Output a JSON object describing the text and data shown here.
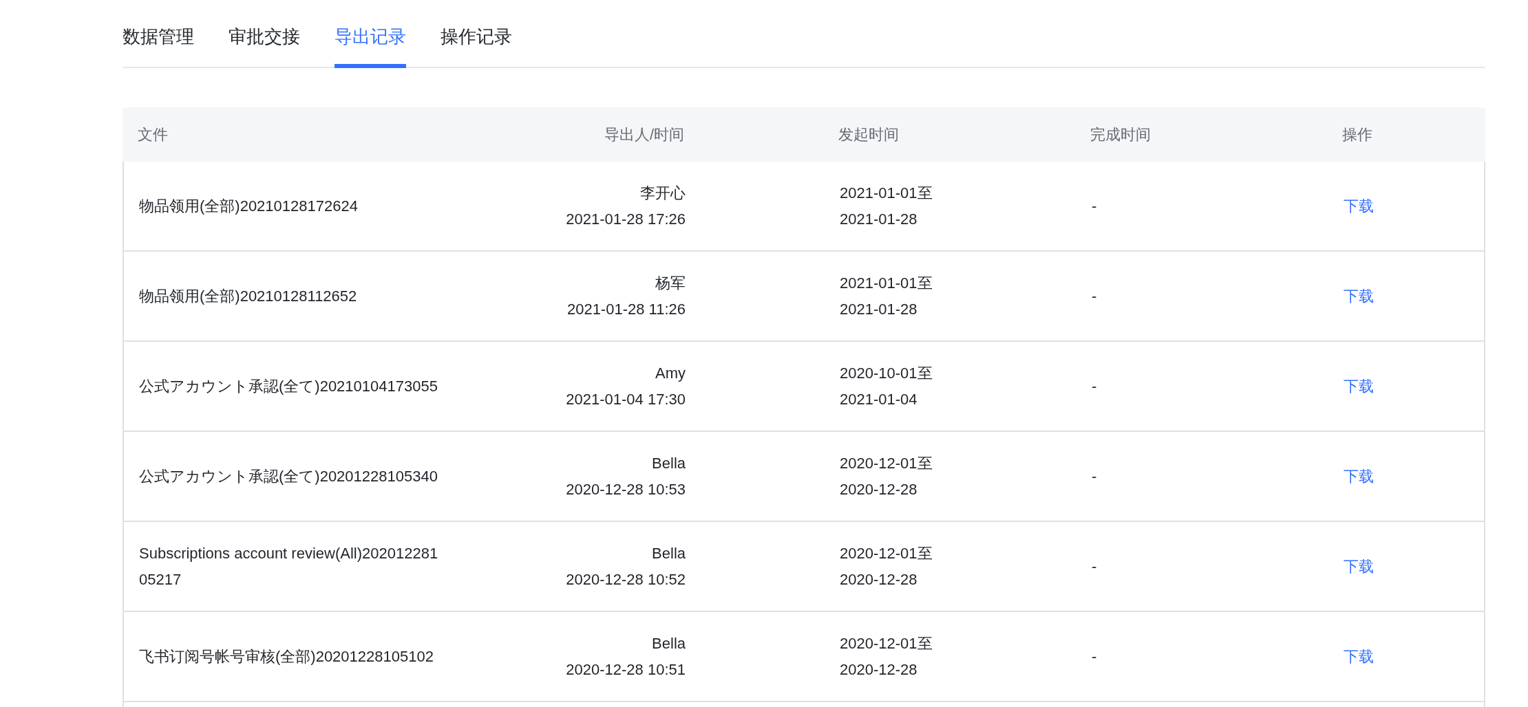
{
  "tabs": [
    {
      "label": "数据管理",
      "selected": false
    },
    {
      "label": "审批交接",
      "selected": false
    },
    {
      "label": "导出记录",
      "selected": true
    },
    {
      "label": "操作记录",
      "selected": false
    }
  ],
  "table": {
    "columns": [
      "文件",
      "导出人/时间",
      "发起时间",
      "完成时间",
      "操作"
    ],
    "rows": [
      {
        "file": "物品领用(全部)20210128172624",
        "exporter": "李开心",
        "export_time": "2021-01-28 17:26",
        "start_from": "2021-01-01至",
        "start_to": "2021-01-28",
        "completed": "-",
        "action": "下载"
      },
      {
        "file": "物品领用(全部)20210128112652",
        "exporter": "杨军",
        "export_time": "2021-01-28 11:26",
        "start_from": "2021-01-01至",
        "start_to": "2021-01-28",
        "completed": "-",
        "action": "下载"
      },
      {
        "file": "公式アカウント承認(全て)20210104173055",
        "exporter": "Amy",
        "export_time": "2021-01-04 17:30",
        "start_from": "2020-10-01至",
        "start_to": "2021-01-04",
        "completed": "-",
        "action": "下载"
      },
      {
        "file": "公式アカウント承認(全て)20201228105340",
        "exporter": "Bella",
        "export_time": "2020-12-28 10:53",
        "start_from": "2020-12-01至",
        "start_to": "2020-12-28",
        "completed": "-",
        "action": "下载"
      },
      {
        "file": "Subscriptions account review(All)20201228105217",
        "exporter": "Bella",
        "export_time": "2020-12-28 10:52",
        "start_from": "2020-12-01至",
        "start_to": "2020-12-28",
        "completed": "-",
        "action": "下载"
      },
      {
        "file": "飞书订阅号帐号审核(全部)20201228105102",
        "exporter": "Bella",
        "export_time": "2020-12-28 10:51",
        "start_from": "2020-12-01至",
        "start_to": "2020-12-28",
        "completed": "-",
        "action": "下载"
      }
    ]
  }
}
